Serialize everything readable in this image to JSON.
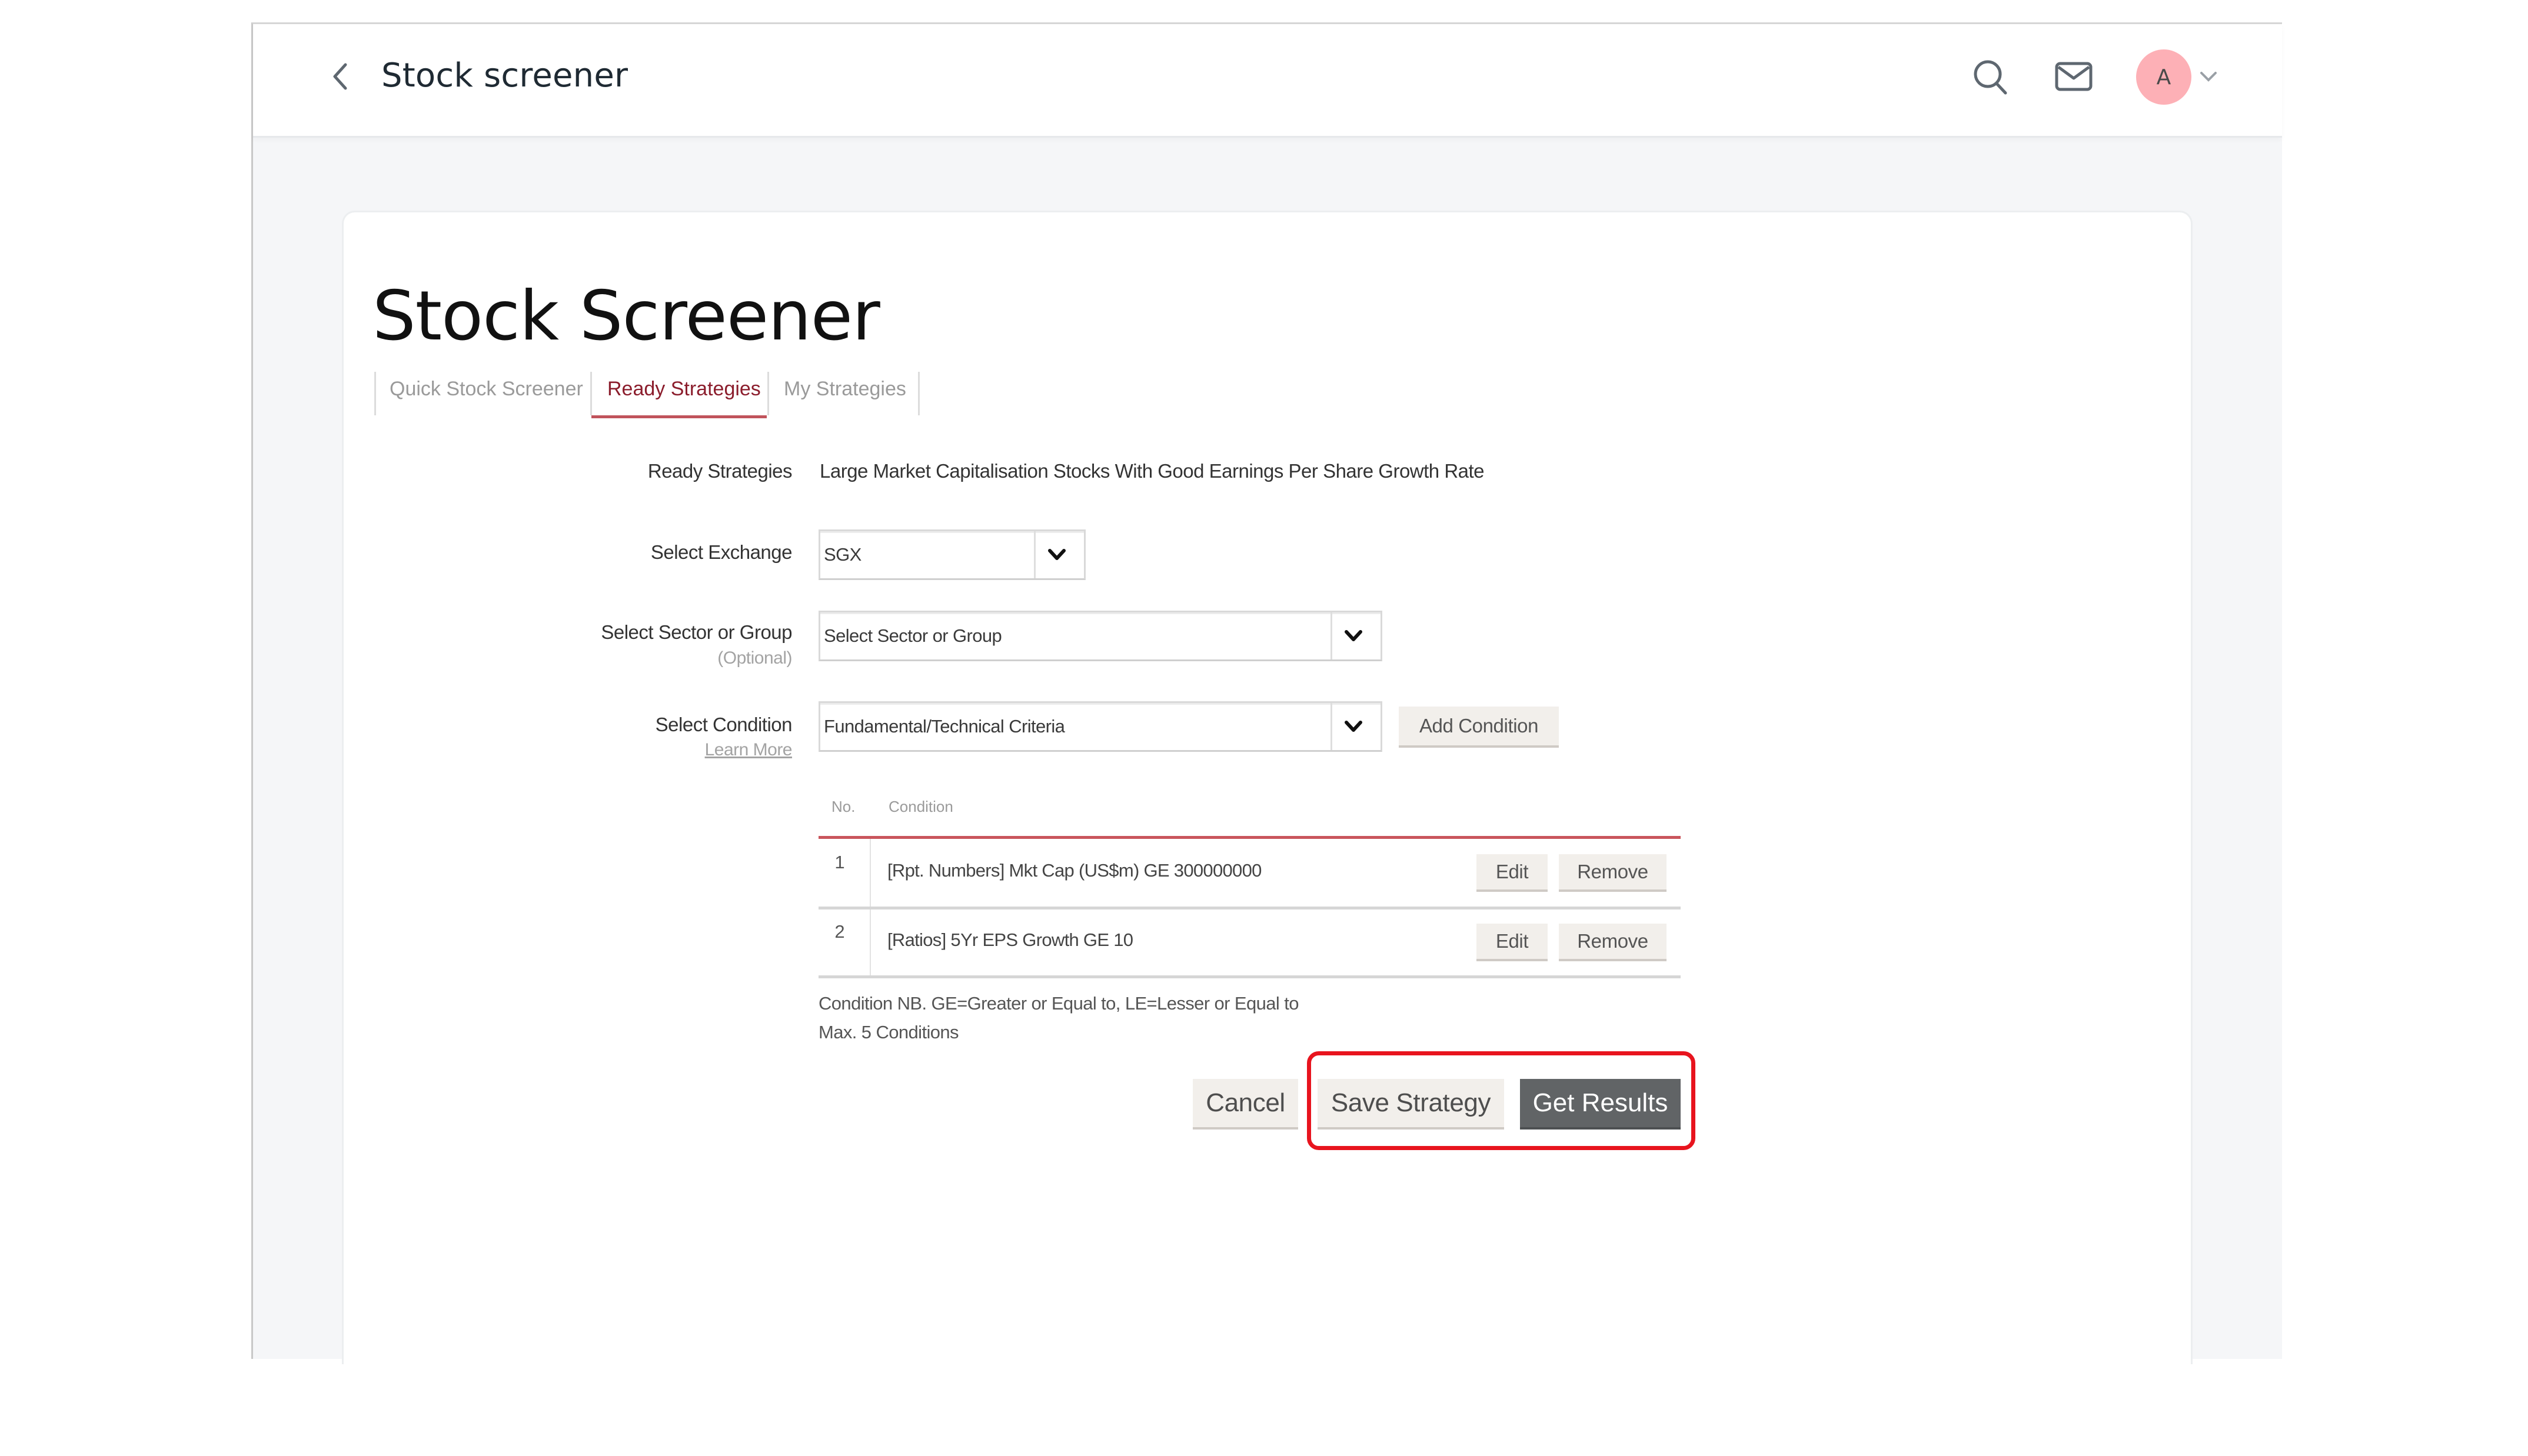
{
  "app": {
    "title": "Stock screener",
    "avatar_initial": "A",
    "icons": {
      "back": "chevron-left-icon",
      "search": "search-icon",
      "mail": "mail-icon",
      "account_menu": "chevron-down-icon"
    }
  },
  "page": {
    "heading": "Stock Screener",
    "tabs": [
      {
        "label": "Quick Stock Screener",
        "active": false
      },
      {
        "label": "Ready Strategies",
        "active": true
      },
      {
        "label": "My Strategies",
        "active": false
      }
    ]
  },
  "form": {
    "ready_strategies": {
      "label": "Ready Strategies",
      "value": "Large Market Capitalisation Stocks With Good Earnings Per Share Growth Rate"
    },
    "exchange": {
      "label": "Select Exchange",
      "value": "SGX"
    },
    "sector": {
      "label": "Select Sector or Group",
      "sublabel": "(Optional)",
      "value": "Select Sector or Group"
    },
    "condition": {
      "label": "Select Condition",
      "link": "Learn More",
      "value": "Fundamental/Technical Criteria",
      "add_button": "Add Condition"
    }
  },
  "conditions_table": {
    "headers": {
      "no": "No.",
      "condition": "Condition"
    },
    "rows": [
      {
        "no": "1",
        "condition": "[Rpt. Numbers] Mkt Cap (US$m) GE 300000000",
        "edit": "Edit",
        "remove": "Remove"
      },
      {
        "no": "2",
        "condition": "[Ratios] 5Yr EPS Growth GE 10",
        "edit": "Edit",
        "remove": "Remove"
      }
    ]
  },
  "notes": {
    "line1": "Condition NB. GE=Greater or Equal to, LE=Lesser or Equal to",
    "line2": "Max. 5 Conditions"
  },
  "actions": {
    "cancel": "Cancel",
    "save": "Save Strategy",
    "get_results": "Get Results"
  },
  "colors": {
    "accent": "#8b1d2c",
    "highlight": "#e8141e",
    "primary_button": "#616466",
    "avatar_bg": "#fdb0b6"
  }
}
